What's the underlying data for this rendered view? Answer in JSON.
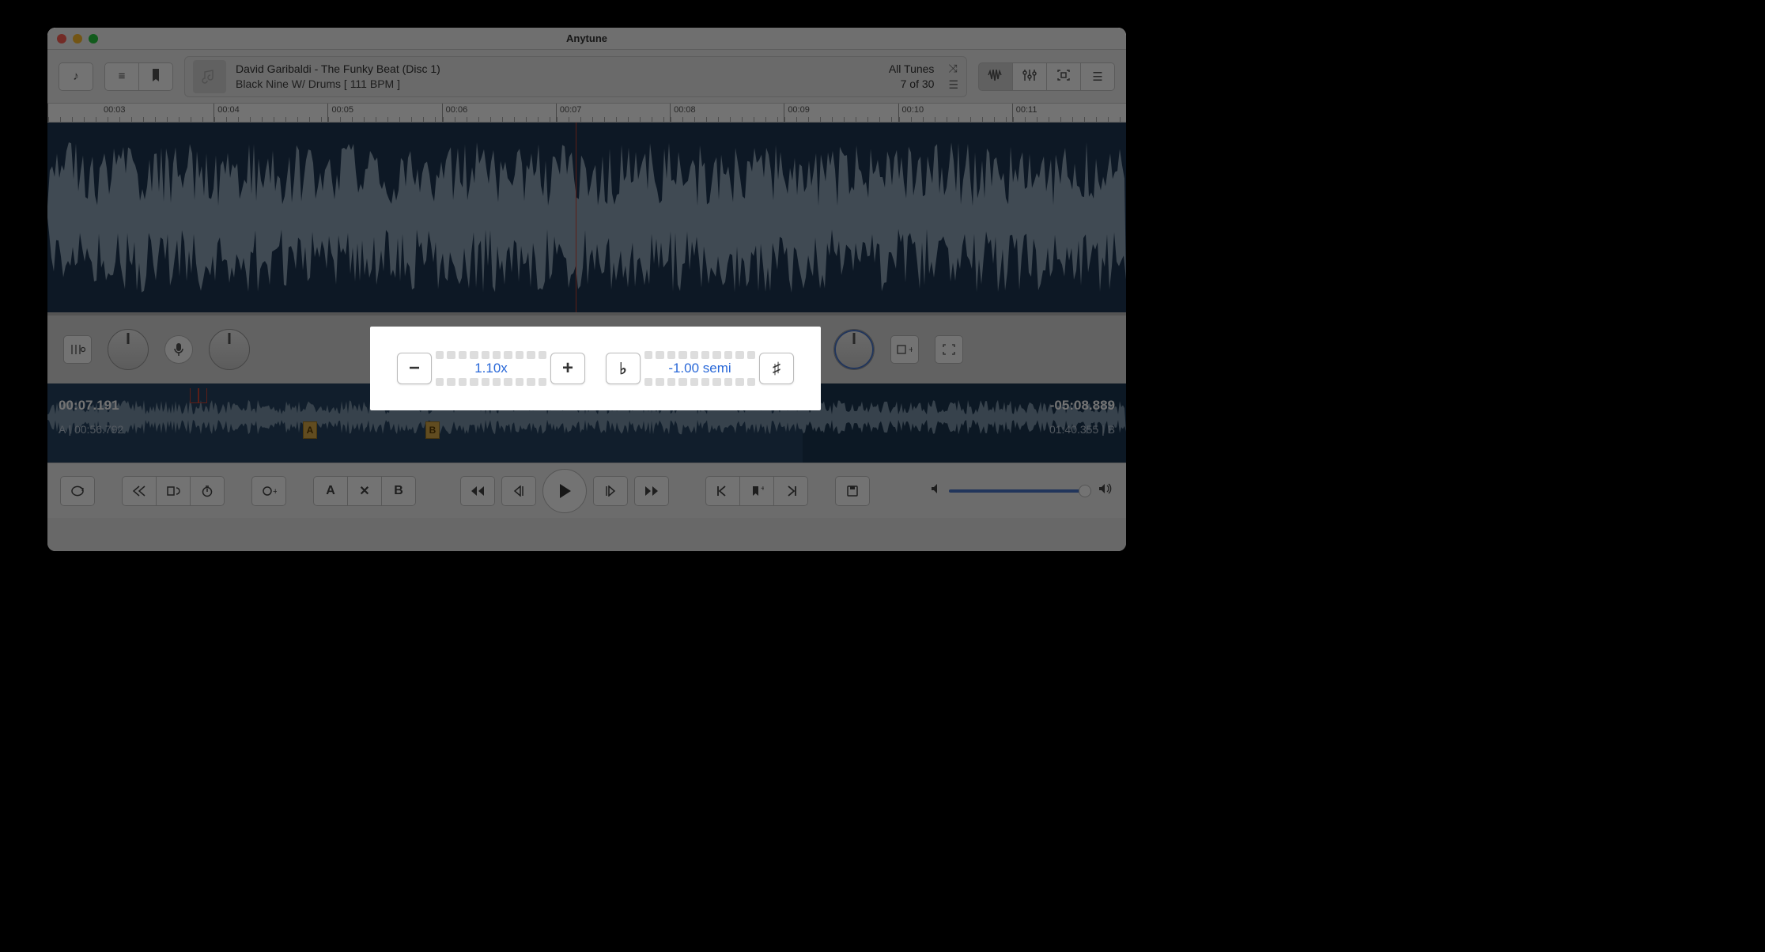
{
  "app": {
    "title": "Anytune"
  },
  "toolbar": {
    "group1": [
      "note"
    ],
    "group2": [
      "list",
      "bookmark"
    ],
    "right_group": [
      "wave",
      "sliders",
      "square",
      "lines"
    ],
    "right_active_index": 0
  },
  "now_playing": {
    "line1": "David Garibaldi - The Funky Beat (Disc 1)",
    "line2": "Black Nine W/ Drums  [ 111 BPM ]",
    "playlist": "All Tunes",
    "index": "7 of 30"
  },
  "ruler_ticks": [
    "00:03",
    "00:04",
    "00:05",
    "00:06",
    "00:07",
    "00:08",
    "00:09",
    "00:10",
    "00:11"
  ],
  "tempo": {
    "value": "1.10x"
  },
  "pitch": {
    "value": "-1.00 semi"
  },
  "overview": {
    "current_time": "00:07.191",
    "remaining": "-05:08.889",
    "loop_a": "A | 00:56.792",
    "loop_b": "01:40.355 | B",
    "marker_a": "A",
    "marker_b": "B"
  },
  "transport": {
    "loop": "⟳",
    "labels": {
      "a": "A",
      "x": "✕",
      "b": "B"
    }
  }
}
